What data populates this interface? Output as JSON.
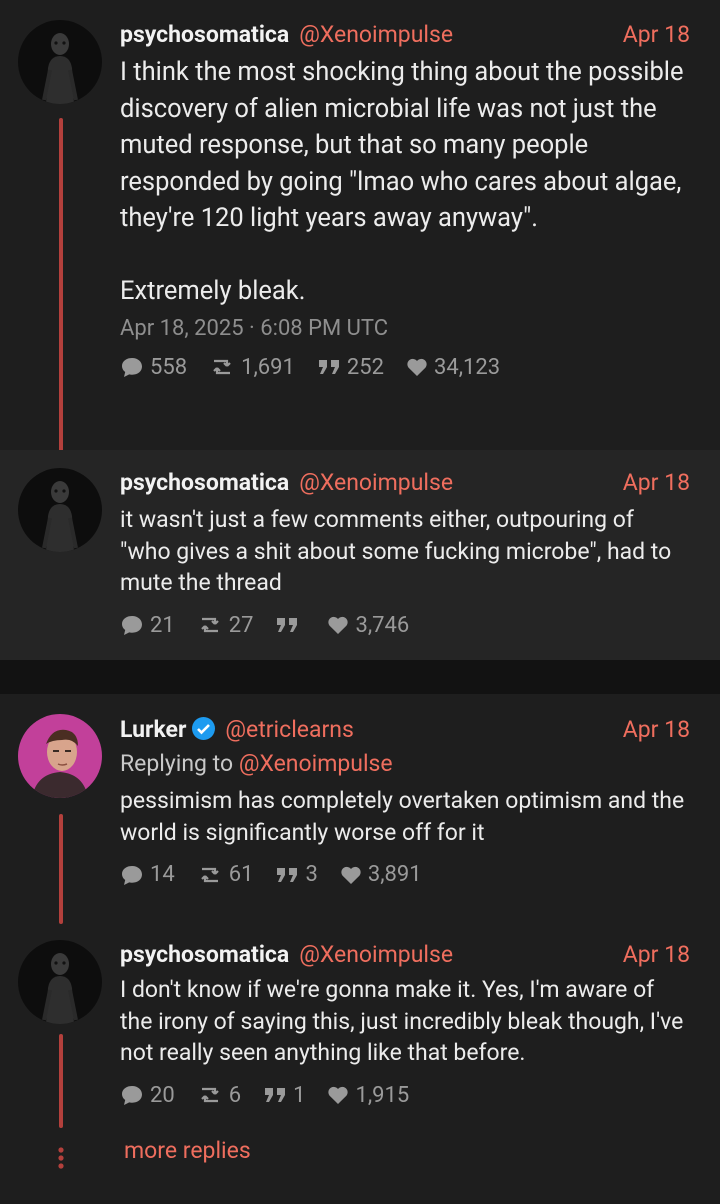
{
  "tweets": [
    {
      "name": "psychosomatica",
      "handle": "@Xenoimpulse",
      "date": "Apr 18",
      "text": "I think the most shocking thing about the possible discovery of alien microbial life was not just the muted response, but that so many people responded by going \"lmao who cares about algae, they're 120 light years away anyway\".\n\nExtremely bleak.",
      "meta": "Apr 18, 2025 · 6:08 PM UTC",
      "replies": "558",
      "retweets": "1,691",
      "quotes": "252",
      "likes": "34,123"
    },
    {
      "name": "psychosomatica",
      "handle": "@Xenoimpulse",
      "date": "Apr 18",
      "text": "it wasn't just a few comments either, outpouring of \"who gives a shit about some fucking microbe\", had to mute the thread",
      "replies": "21",
      "retweets": "27",
      "quotes": "",
      "likes": "3,746"
    },
    {
      "name": "Lurker",
      "handle": "@etriclearns",
      "date": "Apr 18",
      "replying_label": "Replying to",
      "replying_handle": "@Xenoimpulse",
      "text": "pessimism has completely overtaken optimism and the world is significantly worse off for it",
      "replies": "14",
      "retweets": "61",
      "quotes": "3",
      "likes": "3,891"
    },
    {
      "name": "psychosomatica",
      "handle": "@Xenoimpulse",
      "date": "Apr 18",
      "text": "I don't know if we're gonna make it. Yes, I'm aware of the irony of saying this, just incredibly bleak though, I've not really seen anything like that before.",
      "replies": "20",
      "retweets": "6",
      "quotes": "1",
      "likes": "1,915"
    }
  ],
  "more_replies": "more replies",
  "colors": {
    "accent": "#ef6e5e",
    "thread_line": "#b3403c",
    "verified": "#1d9bf0"
  }
}
